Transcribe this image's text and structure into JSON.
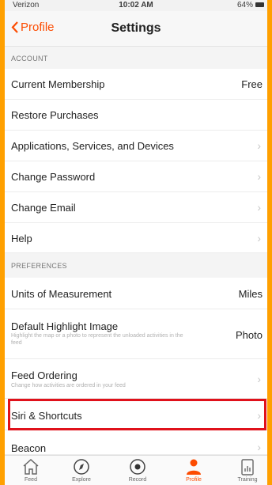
{
  "status_bar": {
    "carrier": "Verizon",
    "time": "10:02 AM",
    "battery": "64%"
  },
  "nav": {
    "back_label": "Profile",
    "title": "Settings"
  },
  "sections": {
    "account": "ACCOUNT",
    "preferences": "PREFERENCES"
  },
  "rows": {
    "membership": {
      "label": "Current Membership",
      "value": "Free"
    },
    "restore": {
      "label": "Restore Purchases"
    },
    "apps": {
      "label": "Applications, Services, and Devices"
    },
    "password": {
      "label": "Change Password"
    },
    "email": {
      "label": "Change Email"
    },
    "help": {
      "label": "Help"
    },
    "units": {
      "label": "Units of Measurement",
      "value": "Miles"
    },
    "highlight": {
      "label": "Default Highlight Image",
      "value": "Photo",
      "sub": "Highlight the map or a photo to represent the unloaded activities in the feed"
    },
    "feed": {
      "label": "Feed Ordering",
      "sub": "Change how activities are ordered in your feed"
    },
    "siri": {
      "label": "Siri & Shortcuts"
    },
    "beacon": {
      "label": "Beacon"
    }
  },
  "tabs": [
    {
      "label": "Feed",
      "icon": "home-icon"
    },
    {
      "label": "Explore",
      "icon": "compass-icon"
    },
    {
      "label": "Record",
      "icon": "record-icon"
    },
    {
      "label": "Profile",
      "icon": "profile-icon"
    },
    {
      "label": "Training",
      "icon": "training-icon"
    }
  ],
  "colors": {
    "accent": "#fc4c02",
    "highlight_box": "#e0111b",
    "frame": "#ffa000"
  }
}
